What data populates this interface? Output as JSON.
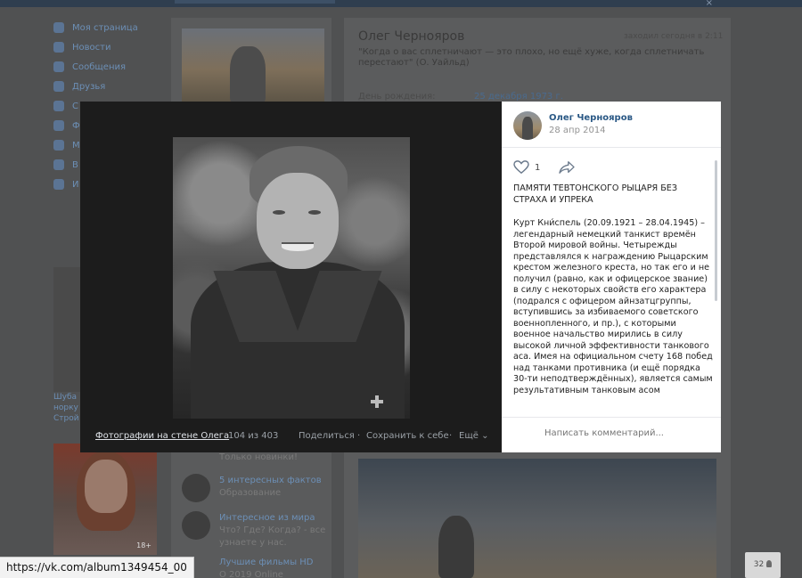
{
  "background": {
    "menu": [
      {
        "label": "Моя страница",
        "icon": "home-icon"
      },
      {
        "label": "Новости",
        "icon": "news-icon"
      },
      {
        "label": "Сообщения",
        "icon": "messages-icon"
      },
      {
        "label": "Друзья",
        "icon": "friends-icon"
      },
      {
        "label": "С",
        "icon": "groups-icon"
      },
      {
        "label": "Ф",
        "icon": "photos-icon"
      },
      {
        "label": "М",
        "icon": "music-icon"
      },
      {
        "label": "В",
        "icon": "videos-icon"
      },
      {
        "label": "И",
        "icon": "games-icon"
      }
    ],
    "profile": {
      "name": "Олег Чернояров",
      "online": "заходил сегодня в 2:11",
      "status": "\"Когда о вас сплетничают — это плохо, но ещё хуже, когда сплетничать перестают\" (О. Уайльд)",
      "birthday_label": "День рождения:",
      "birthday_value": "25 декабря 1973 г."
    },
    "ad_left_text": "Шуба норку Строй",
    "ad_badge": "18+",
    "recommendations": [
      {
        "title": "",
        "subtitle": "Только новинки!"
      },
      {
        "title": "5 интересных фактов",
        "subtitle": "Образование"
      },
      {
        "title": "Интересное из мира",
        "subtitle": "Что? Где? Когда? - все"
      },
      {
        "title": "",
        "subtitle": "узнаете у нас."
      },
      {
        "title": "Лучшие фильмы HD",
        "subtitle": "О 2019 Online"
      }
    ]
  },
  "viewer": {
    "album_link": "Фотографии на стене Олега",
    "counter": "104 из 403",
    "share": "Поделиться",
    "separator": "·",
    "save": "Сохранить к себе",
    "more": "Ещё",
    "author": "Олег Чернояров",
    "date": "28 апр 2014",
    "likes": "1",
    "post_title": "ПАМЯТИ ТЕВТОНСКОГО РЫЦАРЯ БЕЗ СТРАХА И УПРЕКА",
    "post_body": "Курт Кни́спель (20.09.1921 – 28.04.1945) – легендарный немецкий танкист времён Второй мировой войны. Четырежды представлялся к награждению Рыцарским крестом железного креста, но так его и не получил (равно, как и офицерское звание) в силу с некоторых свойств его характера (подрался с офицером айнзатцгруппы, вступившись за избиваемого советского военнопленного, и пр.), с которыми военное начальство мирились в силу высокой личной эффективности танкового аса. Имея на официальном счету 168 побед над танками противника (и ещё порядка 30-ти неподтверждённых), является самым результативным танковым асом",
    "comment_placeholder": "Написать комментарий..."
  },
  "status_url": "https://vk.com/album1349454_00",
  "online_count": "32"
}
